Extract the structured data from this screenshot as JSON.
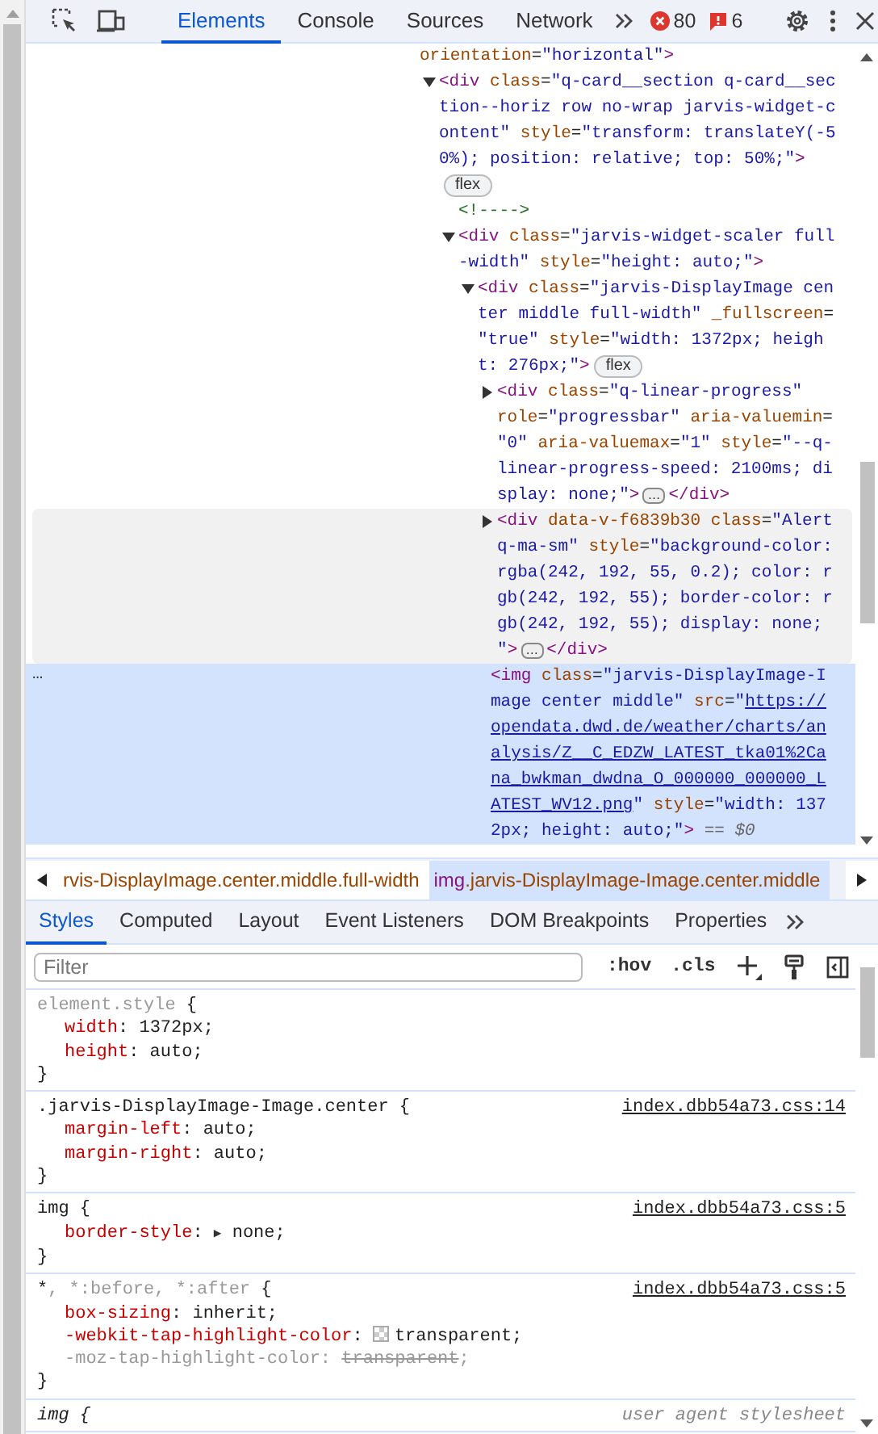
{
  "toolbar": {
    "tabs": [
      {
        "label": "Elements",
        "selected": true
      },
      {
        "label": "Console",
        "selected": false
      },
      {
        "label": "Sources",
        "selected": false
      },
      {
        "label": "Network",
        "selected": false
      }
    ],
    "errors": "80",
    "issues": "6"
  },
  "dom": {
    "nodes": [
      {
        "selected": false,
        "hovered": false,
        "lines": [
          [
            {
              "kind": "attr",
              "text": "orientation"
            },
            {
              "kind": "punct",
              "text": "="
            },
            {
              "kind": "val",
              "text": "\"horizontal\""
            },
            {
              "kind": "tag",
              "text": ">"
            }
          ]
        ],
        "children": [
          {
            "selected": false,
            "hovered": false,
            "expanded": true,
            "lines": [
              [
                {
                  "kind": "tag",
                  "text": "<div"
                },
                {
                  "kind": "attr",
                  "text": " class"
                },
                {
                  "kind": "punct",
                  "text": "="
                },
                {
                  "kind": "val",
                  "text": "\"q-card__section q-card__sec"
                }
              ],
              [
                {
                  "kind": "val",
                  "text": "tion--horiz row no-wrap jarvis-widget-c"
                }
              ],
              [
                {
                  "kind": "val",
                  "text": "ontent\""
                },
                {
                  "kind": "attr",
                  "text": " style"
                },
                {
                  "kind": "punct",
                  "text": "="
                },
                {
                  "kind": "val",
                  "text": "\"transform: translateY(-5"
                }
              ],
              [
                {
                  "kind": "val",
                  "text": "0%); position: relative; top: 50%;\""
                },
                {
                  "kind": "tag",
                  "text": ">"
                }
              ],
              [
                {
                  "kind": "badge",
                  "text": "flex"
                }
              ]
            ],
            "children": [
              {
                "selected": false,
                "hovered": false,
                "lines": [
                  [
                    {
                      "kind": "comment",
                      "text": "<!---->"
                    }
                  ]
                ]
              },
              {
                "selected": false,
                "hovered": false,
                "expanded": true,
                "lines": [
                  [
                    {
                      "kind": "tag",
                      "text": "<div"
                    },
                    {
                      "kind": "attr",
                      "text": " class"
                    },
                    {
                      "kind": "punct",
                      "text": "="
                    },
                    {
                      "kind": "val",
                      "text": "\"jarvis-widget-scaler full"
                    }
                  ],
                  [
                    {
                      "kind": "val",
                      "text": "-width\""
                    },
                    {
                      "kind": "attr",
                      "text": " style"
                    },
                    {
                      "kind": "punct",
                      "text": "="
                    },
                    {
                      "kind": "val",
                      "text": "\"height: auto;\""
                    },
                    {
                      "kind": "tag",
                      "text": ">"
                    }
                  ]
                ],
                "children": [
                  {
                    "selected": false,
                    "hovered": false,
                    "expanded": true,
                    "lines": [
                      [
                        {
                          "kind": "tag",
                          "text": "<div"
                        },
                        {
                          "kind": "attr",
                          "text": " class"
                        },
                        {
                          "kind": "punct",
                          "text": "="
                        },
                        {
                          "kind": "val",
                          "text": "\"jarvis-DisplayImage cen"
                        }
                      ],
                      [
                        {
                          "kind": "val",
                          "text": "ter middle full-width\""
                        },
                        {
                          "kind": "attr",
                          "text": " _fullscreen"
                        },
                        {
                          "kind": "punct",
                          "text": "="
                        }
                      ],
                      [
                        {
                          "kind": "val",
                          "text": "\"true\""
                        },
                        {
                          "kind": "attr",
                          "text": " style"
                        },
                        {
                          "kind": "punct",
                          "text": "="
                        },
                        {
                          "kind": "val",
                          "text": "\"width: 1372px; heigh"
                        }
                      ],
                      [
                        {
                          "kind": "val",
                          "text": "t: 276px;\""
                        },
                        {
                          "kind": "tag",
                          "text": ">"
                        },
                        {
                          "kind": "badge",
                          "text": "flex"
                        }
                      ]
                    ],
                    "children": [
                      {
                        "selected": false,
                        "hovered": false,
                        "expanded": false,
                        "lines": [
                          [
                            {
                              "kind": "tag",
                              "text": "<div"
                            },
                            {
                              "kind": "attr",
                              "text": " class"
                            },
                            {
                              "kind": "punct",
                              "text": "="
                            },
                            {
                              "kind": "val",
                              "text": "\"q-linear-progress\""
                            }
                          ],
                          [
                            {
                              "kind": "attr",
                              "text": "role"
                            },
                            {
                              "kind": "punct",
                              "text": "="
                            },
                            {
                              "kind": "val",
                              "text": "\"progressbar\""
                            },
                            {
                              "kind": "attr",
                              "text": " aria-valuemin"
                            },
                            {
                              "kind": "punct",
                              "text": "="
                            }
                          ],
                          [
                            {
                              "kind": "val",
                              "text": "\"0\""
                            },
                            {
                              "kind": "attr",
                              "text": " aria-valuemax"
                            },
                            {
                              "kind": "punct",
                              "text": "="
                            },
                            {
                              "kind": "val",
                              "text": "\"1\""
                            },
                            {
                              "kind": "attr",
                              "text": " style"
                            },
                            {
                              "kind": "punct",
                              "text": "="
                            },
                            {
                              "kind": "val",
                              "text": "\"--q-"
                            }
                          ],
                          [
                            {
                              "kind": "val",
                              "text": "linear-progress-speed: 2100ms; di"
                            }
                          ],
                          [
                            {
                              "kind": "val",
                              "text": "splay: none;\""
                            },
                            {
                              "kind": "tag",
                              "text": ">"
                            },
                            {
                              "kind": "ellipsis",
                              "text": "…"
                            },
                            {
                              "kind": "tag",
                              "text": "</div>"
                            }
                          ]
                        ]
                      },
                      {
                        "selected": false,
                        "hovered": true,
                        "expanded": false,
                        "lines": [
                          [
                            {
                              "kind": "tag",
                              "text": "<div"
                            },
                            {
                              "kind": "attr",
                              "text": " data-v-f6839b30 class"
                            },
                            {
                              "kind": "punct",
                              "text": "="
                            },
                            {
                              "kind": "val",
                              "text": "\"Alert"
                            }
                          ],
                          [
                            {
                              "kind": "val",
                              "text": "q-ma-sm\""
                            },
                            {
                              "kind": "attr",
                              "text": " style"
                            },
                            {
                              "kind": "punct",
                              "text": "="
                            },
                            {
                              "kind": "val",
                              "text": "\"background-color:"
                            }
                          ],
                          [
                            {
                              "kind": "val",
                              "text": "rgba(242, 192, 55, 0.2); color: r"
                            }
                          ],
                          [
                            {
                              "kind": "val",
                              "text": "gb(242, 192, 55); border-color: r"
                            }
                          ],
                          [
                            {
                              "kind": "val",
                              "text": "gb(242, 192, 55); display: none;"
                            }
                          ],
                          [
                            {
                              "kind": "val",
                              "text": "\""
                            },
                            {
                              "kind": "tag",
                              "text": ">"
                            },
                            {
                              "kind": "ellipsis",
                              "text": "…"
                            },
                            {
                              "kind": "tag",
                              "text": "</div>"
                            }
                          ]
                        ]
                      },
                      {
                        "selected": true,
                        "hovered": false,
                        "gutter": "…",
                        "lines": [
                          [
                            {
                              "kind": "tag",
                              "text": "<img"
                            },
                            {
                              "kind": "attr",
                              "text": " class"
                            },
                            {
                              "kind": "punct",
                              "text": "="
                            },
                            {
                              "kind": "val",
                              "text": "\"jarvis-DisplayImage-I"
                            }
                          ],
                          [
                            {
                              "kind": "val",
                              "text": "mage center middle\""
                            },
                            {
                              "kind": "attr",
                              "text": " src"
                            },
                            {
                              "kind": "punct",
                              "text": "="
                            },
                            {
                              "kind": "val",
                              "text": "\""
                            },
                            {
                              "kind": "link",
                              "text": "https://"
                            }
                          ],
                          [
                            {
                              "kind": "link",
                              "text": "opendata.dwd.de/weather/charts/an"
                            }
                          ],
                          [
                            {
                              "kind": "link",
                              "text": "alysis/Z__C_EDZW_LATEST_tka01%2Ca"
                            }
                          ],
                          [
                            {
                              "kind": "link",
                              "text": "na_bwkman_dwdna_O_000000_000000_L"
                            }
                          ],
                          [
                            {
                              "kind": "link",
                              "text": "ATEST_WV12.png"
                            },
                            {
                              "kind": "val",
                              "text": "\""
                            },
                            {
                              "kind": "attr",
                              "text": " style"
                            },
                            {
                              "kind": "punct",
                              "text": "="
                            },
                            {
                              "kind": "val",
                              "text": "\"width: 137"
                            }
                          ],
                          [
                            {
                              "kind": "val",
                              "text": "2px; height: auto;\""
                            },
                            {
                              "kind": "tag",
                              "text": ">"
                            },
                            {
                              "kind": "dollar",
                              "text": " == $0"
                            }
                          ]
                        ]
                      }
                    ]
                  }
                ]
              }
            ]
          }
        ]
      }
    ]
  },
  "breadcrumbs": [
    {
      "selected": false,
      "tokens": [
        {
          "kind": "attr",
          "text": "rvis-DisplayImage.center.middle.full-width"
        }
      ]
    },
    {
      "selected": true,
      "tokens": [
        {
          "kind": "tag",
          "text": "img"
        },
        {
          "kind": "attr",
          "text": ".jarvis-DisplayImage-Image.center.middle"
        }
      ]
    }
  ],
  "sidebar_tabs": [
    {
      "label": "Styles",
      "selected": true
    },
    {
      "label": "Computed",
      "selected": false
    },
    {
      "label": "Layout",
      "selected": false
    },
    {
      "label": "Event Listeners",
      "selected": false
    },
    {
      "label": "DOM Breakpoints",
      "selected": false
    },
    {
      "label": "Properties",
      "selected": false
    }
  ],
  "filter": {
    "placeholder": "Filter"
  },
  "style_buttons": [
    ":hov",
    ".cls"
  ],
  "rules": [
    {
      "selector": [
        {
          "kind": "dim",
          "text": "element.style"
        },
        {
          "kind": "plain",
          "text": " {"
        }
      ],
      "declarations": [
        {
          "tokens": [
            {
              "kind": "name",
              "text": "width"
            },
            {
              "kind": "plain",
              "text": ": 1372px;"
            }
          ]
        },
        {
          "tokens": [
            {
              "kind": "name",
              "text": "height"
            },
            {
              "kind": "plain",
              "text": ": auto;"
            }
          ]
        }
      ],
      "close": "}"
    },
    {
      "source": "index.dbb54a73.css:14",
      "selector": [
        {
          "kind": "plain",
          "text": ".jarvis-DisplayImage-Image.center {"
        }
      ],
      "declarations": [
        {
          "tokens": [
            {
              "kind": "name",
              "text": "margin-left"
            },
            {
              "kind": "plain",
              "text": ": auto;"
            }
          ]
        },
        {
          "tokens": [
            {
              "kind": "name",
              "text": "margin-right"
            },
            {
              "kind": "plain",
              "text": ": auto;"
            }
          ]
        }
      ],
      "close": "}"
    },
    {
      "source": "index.dbb54a73.css:5",
      "selector": [
        {
          "kind": "plain",
          "text": "img {"
        }
      ],
      "declarations": [
        {
          "tokens": [
            {
              "kind": "name",
              "text": "border-style"
            },
            {
              "kind": "plain",
              "text": ": "
            },
            {
              "kind": "expander",
              "text": "▶"
            },
            {
              "kind": "plain",
              "text": " none;"
            }
          ]
        }
      ],
      "close": "}"
    },
    {
      "source": "index.dbb54a73.css:5",
      "selector": [
        {
          "kind": "plain",
          "text": "*"
        },
        {
          "kind": "dim",
          "text": ", *:before, *:after"
        },
        {
          "kind": "plain",
          "text": " {"
        }
      ],
      "declarations": [
        {
          "tokens": [
            {
              "kind": "name",
              "text": "box-sizing"
            },
            {
              "kind": "plain",
              "text": ": inherit;"
            }
          ]
        },
        {
          "tokens": [
            {
              "kind": "name",
              "text": "-webkit-tap-highlight-color"
            },
            {
              "kind": "plain",
              "text": ": "
            },
            {
              "kind": "swatch"
            },
            {
              "kind": "plain",
              "text": "transparent;"
            }
          ]
        },
        {
          "tokens": [
            {
              "kind": "dim",
              "text": "-moz-tap-highlight-color: "
            },
            {
              "kind": "struck",
              "text": "transparent"
            },
            {
              "kind": "dim",
              "text": ";"
            }
          ]
        }
      ],
      "close": "}"
    },
    {
      "source": "user agent stylesheet",
      "selector": [
        {
          "kind": "italic",
          "text": "img {"
        }
      ]
    }
  ]
}
